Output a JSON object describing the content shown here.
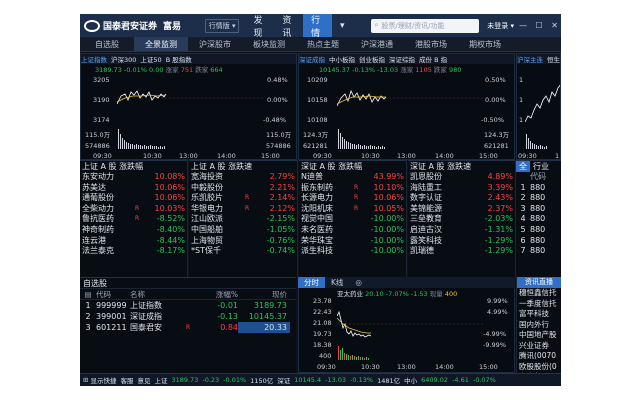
{
  "app": {
    "logo_text": "国泰君安证券",
    "brand": "富易",
    "mode": "行情版 ▾",
    "nav": [
      "发现",
      "资讯",
      "行情"
    ],
    "active_nav": "行情",
    "nav_more": "▾",
    "search_placeholder": "股票/理财/资讯/功能",
    "login": "未登录 ▾",
    "window_controls": "— ☐ ✕"
  },
  "tabs": [
    "自选股",
    "全景监测",
    "沪深股市",
    "板块监测",
    "热点主题",
    "沪深港通",
    "港股市场",
    "期权市场"
  ],
  "active_tab": "全景监测",
  "charts": {
    "sh": {
      "tabs": [
        "上证指数",
        "沪深300",
        "上证50",
        "B 股指数"
      ],
      "price": "3189.73",
      "chg": "-0.01%",
      "pts": "0.00",
      "up_label": "涨家",
      "up": "751",
      "down_label": "跌家",
      "down": "664",
      "y_left": [
        "3205",
        "3190",
        "3174"
      ],
      "y_right": [
        "0.48%",
        "0.00%",
        "-0.48%"
      ],
      "vol": [
        "115.0万",
        "574886"
      ],
      "x": [
        "09:30",
        "10:30",
        "13:00",
        "14:00",
        "15:00"
      ]
    },
    "sz": {
      "tabs": [
        "深证成指",
        "中小板指",
        "创业板指",
        "深证综指",
        "成份 B 指"
      ],
      "price": "10145.37",
      "chg": "-0.13%",
      "pts": "-13.03",
      "up_label": "涨家",
      "up": "1105",
      "down_label": "跌家",
      "down": "980",
      "y_left": [
        "10209",
        "10158",
        "10108"
      ],
      "y_right": [
        "0.50%",
        "0.00%",
        "-0.50%"
      ],
      "vol": [
        "124.3万",
        "621281"
      ],
      "x": [
        "09:30",
        "10:30",
        "13:00",
        "14:00",
        "15:00"
      ]
    },
    "hk": {
      "tabs": [
        "沪深主连",
        "恒生"
      ],
      "y_left": [
        "1",
        "1",
        "1"
      ],
      "x": [
        "09:30",
        "1"
      ]
    }
  },
  "rank": [
    {
      "title": "上证 A 股 涨跌幅",
      "rows": [
        {
          "name": "东安动力",
          "value": "10.08%",
          "dir": "up"
        },
        {
          "name": "苏美达",
          "value": "10.06%",
          "dir": "up"
        },
        {
          "name": "通葡股份",
          "value": "10.06%",
          "dir": "up"
        },
        {
          "name": "全柴动力",
          "value": "10.03%",
          "dir": "up",
          "mark": "R"
        },
        {
          "name": "鲁抗医药",
          "value": "-8.52%",
          "dir": "down",
          "mark": "R"
        },
        {
          "name": "神奇制药",
          "value": "-8.40%",
          "dir": "down"
        },
        {
          "name": "连云港",
          "value": "-8.44%",
          "dir": "down"
        },
        {
          "name": "法兰泰克",
          "value": "-8.17%",
          "dir": "down"
        }
      ]
    },
    {
      "title": "上证 A 股 涨跌速",
      "rows": [
        {
          "name": "宽海投资",
          "value": "2.79%",
          "dir": "up"
        },
        {
          "name": "中毅股份",
          "value": "2.21%",
          "dir": "up"
        },
        {
          "name": "乐凯胶片",
          "value": "2.14%",
          "dir": "up",
          "mark": "R"
        },
        {
          "name": "华银电力",
          "value": "2.12%",
          "dir": "up",
          "mark": "R"
        },
        {
          "name": "江山欧派",
          "value": "-2.15%",
          "dir": "down"
        },
        {
          "name": "中国船舶",
          "value": "-1.05%",
          "dir": "down"
        },
        {
          "name": "上海物贸",
          "value": "-0.76%",
          "dir": "down"
        },
        {
          "name": "*ST保千",
          "value": "-0.74%",
          "dir": "down"
        }
      ]
    },
    {
      "title": "深证 A 股 涨跌幅",
      "rows": [
        {
          "name": "N迪普",
          "value": "43.99%",
          "dir": "up"
        },
        {
          "name": "振东制药",
          "value": "10.10%",
          "dir": "up",
          "mark": "R"
        },
        {
          "name": "长源电力",
          "value": "10.06%",
          "dir": "up",
          "mark": "R"
        },
        {
          "name": "沈阳机床",
          "value": "10.05%",
          "dir": "up",
          "mark": "R"
        },
        {
          "name": "视觉中国",
          "value": "-10.00%",
          "dir": "down"
        },
        {
          "name": "未名医药",
          "value": "-10.00%",
          "dir": "down"
        },
        {
          "name": "荣华珠宝",
          "value": "-10.00%",
          "dir": "down"
        },
        {
          "name": "派生科技",
          "value": "-10.00%",
          "dir": "down"
        }
      ]
    },
    {
      "title": "深证 A 股 涨跌速",
      "rows": [
        {
          "name": "凯恩股份",
          "value": "4.89%",
          "dir": "up"
        },
        {
          "name": "海陆重工",
          "value": "3.39%",
          "dir": "up"
        },
        {
          "name": "数字认证",
          "value": "2.43%",
          "dir": "up"
        },
        {
          "name": "美锦能源",
          "value": "2.37%",
          "dir": "up"
        },
        {
          "name": "三垒教育",
          "value": "-2.03%",
          "dir": "down"
        },
        {
          "name": "启迪古汉",
          "value": "-1.31%",
          "dir": "down"
        },
        {
          "name": "露笑科技",
          "value": "-1.29%",
          "dir": "down"
        },
        {
          "name": "凯瑞德",
          "value": "-1.29%",
          "dir": "down"
        }
      ]
    }
  ],
  "right_table": {
    "head": [
      "全",
      "行业"
    ],
    "col": "代码",
    "rows": [
      {
        "n": "1",
        "code": "880"
      },
      {
        "n": "2",
        "code": "880"
      },
      {
        "n": "3",
        "code": "880"
      },
      {
        "n": "4",
        "code": "880"
      },
      {
        "n": "5",
        "code": "880"
      },
      {
        "n": "6",
        "code": "880"
      },
      {
        "n": "7",
        "code": "880"
      }
    ]
  },
  "watchlist": {
    "title": "自选股",
    "headers": [
      "",
      "代码",
      "名称",
      "涨幅%",
      "现价"
    ],
    "rows": [
      {
        "n": "1",
        "code": "999999",
        "name": "上证指数",
        "chg": "-0.01",
        "price": "3189.73",
        "dir": "down"
      },
      {
        "n": "2",
        "code": "399001",
        "name": "深证成指",
        "chg": "-0.13",
        "price": "10145.37",
        "dir": "down"
      },
      {
        "n": "3",
        "code": "601211",
        "name": "国泰君安",
        "mark": "R",
        "chg": "0.84",
        "price": "20.33",
        "dir": "up"
      }
    ]
  },
  "stock_tabs": [
    "分时",
    "K线",
    "◎"
  ],
  "stock_chart": {
    "name": "亚太药业",
    "price": "20.10",
    "chg": "-7.07%",
    "pts": "-1.53",
    "vol_label": "现量",
    "vol": "400",
    "y_left": [
      "23.78",
      "22.43",
      "21.08",
      "19.73",
      "18.38"
    ],
    "y_right": [
      "9.99%",
      "4.99%",
      "-4.99%",
      "-9.99%"
    ],
    "vol_y": "400",
    "x": [
      "09:30",
      "10:30",
      "13:00",
      "14:00",
      "15:00"
    ]
  },
  "news": {
    "tab": "资讯直播",
    "items": [
      "穗恒鑫信托",
      "一季度信托",
      "富平科技",
      "国内外行",
      "中国地产股",
      "兴业证券",
      "腾讯(0070",
      "欧股股份(0",
      "中宣永股"
    ]
  },
  "status": {
    "items": [
      {
        "text": "显示快捷",
        "cls": "wht"
      },
      {
        "text": "客服",
        "cls": "wht"
      },
      {
        "text": "意见",
        "cls": "wht"
      },
      {
        "text": "上证",
        "cls": "wht"
      },
      {
        "text": "3189.73",
        "cls": "green"
      },
      {
        "text": "-0.23",
        "cls": "green"
      },
      {
        "text": "-0.01%",
        "cls": "green"
      },
      {
        "text": "1150亿",
        "cls": "wht"
      },
      {
        "text": "深证",
        "cls": "wht"
      },
      {
        "text": "10145.4",
        "cls": "green"
      },
      {
        "text": "-13.03",
        "cls": "green"
      },
      {
        "text": "-0.13%",
        "cls": "green"
      },
      {
        "text": "1481亿",
        "cls": "wht"
      },
      {
        "text": "中小",
        "cls": "wht"
      },
      {
        "text": "6409.02",
        "cls": "green"
      },
      {
        "text": "-4.61",
        "cls": "green"
      },
      {
        "text": "-0.07%",
        "cls": "green"
      }
    ]
  },
  "colors": {
    "up": "#ff4040",
    "down": "#29c45a",
    "accent": "#2f6fc7",
    "line": "#ffffff",
    "avg": "#e9c247"
  }
}
